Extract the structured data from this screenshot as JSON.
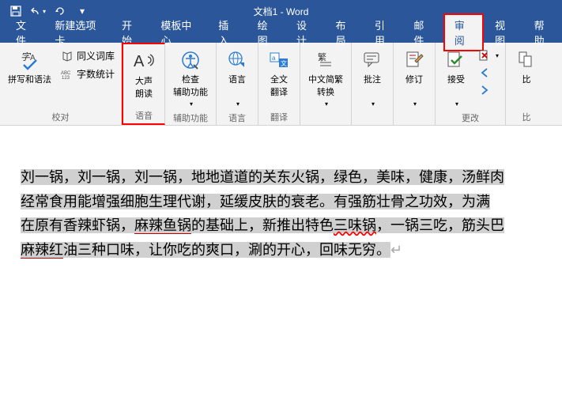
{
  "title": "文档1 - Word",
  "tabs": {
    "file": "文件",
    "newtab": "新建选项卡",
    "start": "开始",
    "template": "模板中心",
    "insert": "插入",
    "draw": "绘图",
    "design": "设计",
    "layout": "布局",
    "refs": "引用",
    "mail": "邮件",
    "review": "审阅",
    "view": "视图",
    "help": "帮助"
  },
  "ribbon": {
    "proofing": {
      "spellgrammar": "拼写和语法",
      "thesaurus": "同义词库",
      "wordcount": "字数统计",
      "group": "校对"
    },
    "speech": {
      "readaloud_l1": "大声",
      "readaloud_l2": "朗读",
      "group": "语音"
    },
    "accessibility": {
      "check_l1": "检查",
      "check_l2": "辅助功能",
      "group": "辅助功能"
    },
    "language": {
      "btn": "语言",
      "group": "语言"
    },
    "translate": {
      "full_l1": "全文",
      "full_l2": "翻译",
      "group": "翻译"
    },
    "chinese": {
      "btn_l1": "中文简繁",
      "btn_l2": "转换",
      "group": ""
    },
    "comments": {
      "btn": "批注",
      "group": ""
    },
    "tracking": {
      "btn": "修订",
      "group": ""
    },
    "changes": {
      "btn": "接受",
      "group": "更改"
    },
    "compare": {
      "btn_l1": "比",
      "group": "比"
    }
  },
  "doc": {
    "l1a": "刘一锅，刘一锅，刘一锅，地地道道的关东火锅，绿色，美味，健康，汤鲜肉",
    "l2a": "经常食用能增强细胞生理代谢，延缓皮肤的衰老。有强筋壮骨之功效，为满",
    "l3a": "在原有香辣虾锅，",
    "l3b": "麻辣鱼锅",
    "l3c": "的基础上，新推出特色",
    "l3d": "三味锅",
    "l3e": "，一锅三吃，筋头巴",
    "l4a": "麻辣红",
    "l4b": "油三种口味，让你吃的爽口，涮的开心，回味无穷。"
  }
}
